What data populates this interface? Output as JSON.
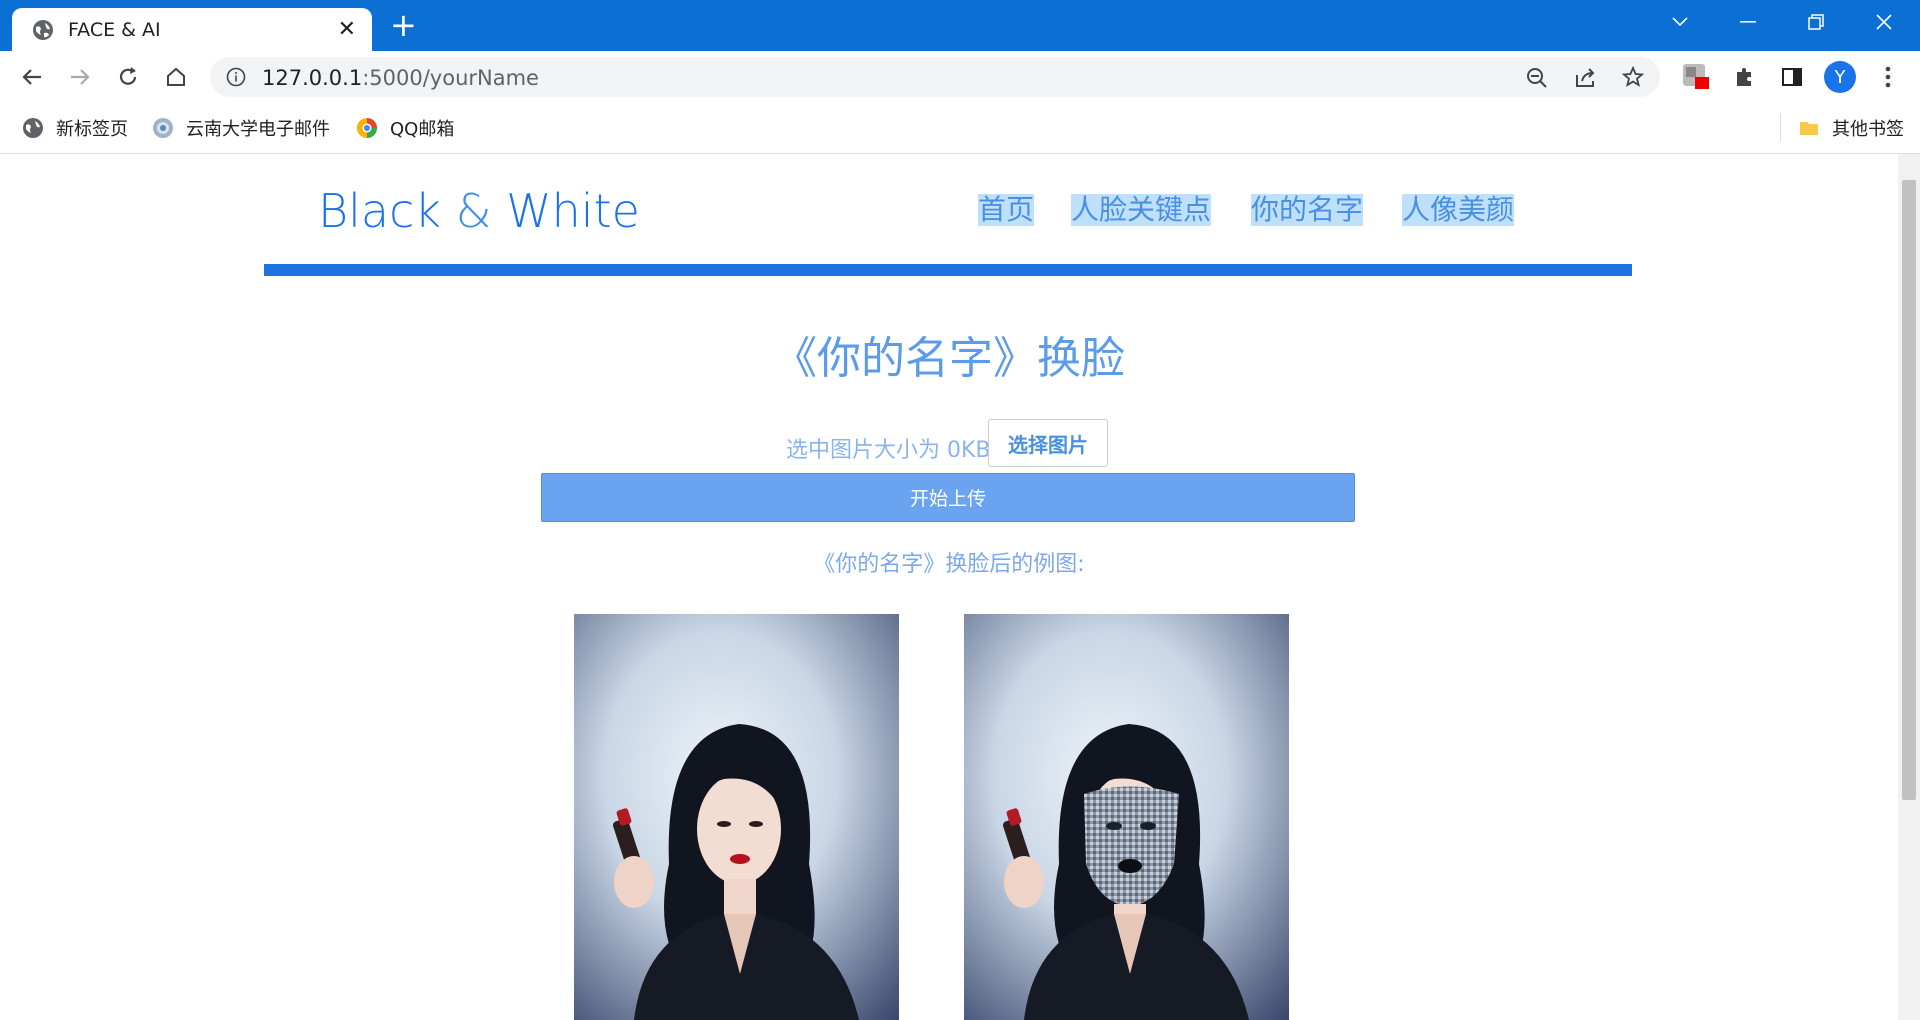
{
  "browser": {
    "tab_title": "FACE & AI",
    "url_host": "127.0.0.1",
    "url_path": ":5000/yourName",
    "profile_initial": "Y",
    "bookmarks": [
      "新标签页",
      "云南大学电子邮件",
      "QQ邮箱"
    ],
    "other_bookmarks": "其他书签"
  },
  "site": {
    "brand_main": "Black",
    "brand_amp": "&",
    "brand_tail": "White",
    "nav": [
      "首页",
      "人脸关键点",
      "你的名字",
      "人像美颜"
    ]
  },
  "main": {
    "heading": "《你的名字》换脸",
    "size_text": "选中图片大小为 0KB",
    "choose_label": "选择图片",
    "upload_label": "开始上传",
    "example_caption": "《你的名字》换脸后的例图:"
  },
  "colors": {
    "accent": "#1f73e0",
    "titlebar": "#0b6fd4",
    "nav_highlight": "#bfe0fb"
  }
}
